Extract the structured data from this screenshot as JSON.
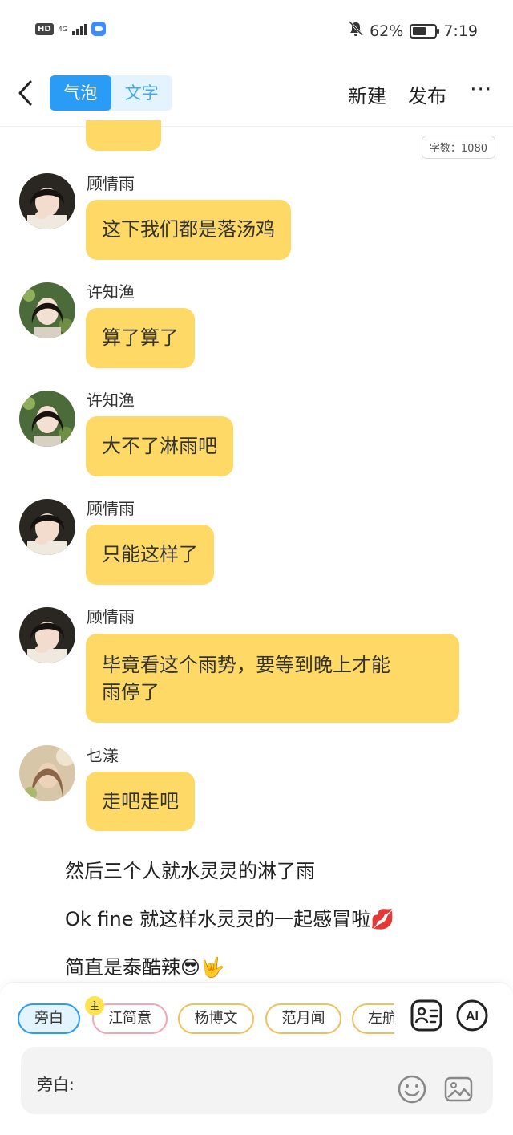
{
  "status_bar": {
    "hd": "HD",
    "network": "4G",
    "battery": "62%",
    "time": "7:19"
  },
  "header": {
    "mode_bubble": "气泡",
    "mode_text": "文字",
    "new_label": "新建",
    "publish_label": "发布",
    "more_label": "···"
  },
  "word_count": "字数：1080",
  "messages": [
    {
      "name": "顾情雨",
      "text": "这下我们都是落汤鸡"
    },
    {
      "name": "许知渔",
      "text": "算了算了"
    },
    {
      "name": "许知渔",
      "text": "大不了淋雨吧"
    },
    {
      "name": "顾情雨",
      "text": "只能这样了"
    },
    {
      "name": "顾情雨",
      "text_line1": "毕竟看这个雨势，要等到晚上才能",
      "text_line2": "雨停了"
    },
    {
      "name": "乜漾",
      "text": "走吧走吧"
    }
  ],
  "narration": [
    "然后三个人就水灵灵的淋了雨",
    "Ok fine 就这样水灵灵的一起感冒啦💋",
    "简直是泰酷辣😎🤟"
  ],
  "characters": {
    "host_badge": "主",
    "items": [
      "旁白",
      "江简意",
      "杨博文",
      "范月闻",
      "左航"
    ]
  },
  "input": {
    "prefix": "旁白:"
  },
  "colors": {
    "bubble": "#ffd966",
    "accent": "#2a9cf5"
  },
  "icons": [
    "back-arrow-icon",
    "contact-card-icon",
    "ai-icon",
    "emoji-icon",
    "image-icon"
  ]
}
